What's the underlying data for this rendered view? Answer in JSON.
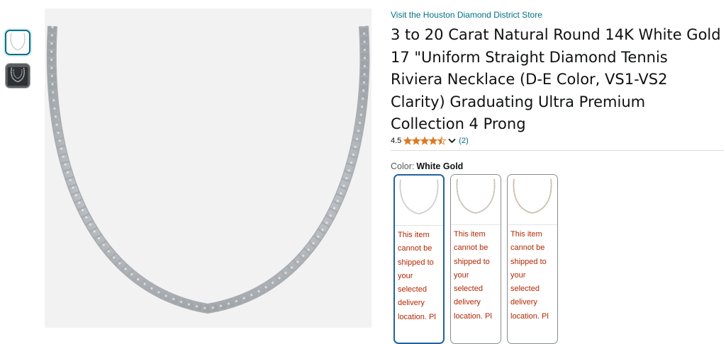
{
  "gallery": {
    "thumbnails": [
      {
        "icon": "necklace-thumbnail-icon",
        "selected": true
      },
      {
        "icon": "necklace-display-thumbnail-icon",
        "selected": false
      }
    ],
    "main_image_icon": "diamond-tennis-necklace-image"
  },
  "product": {
    "store_link": "Visit the Houston Diamond District Store",
    "title": "3 to 20 Carat Natural Round 14K White Gold 17 \"Uniform Straight Diamond Tennis Riviera Necklace (D-E Color, VS1-VS2 Clarity) Graduating Ultra Premium Collection 4 Prong",
    "rating": {
      "value": "4.5",
      "stars": 4.5,
      "count": "(2)",
      "star_color": "#DE7921"
    }
  },
  "color": {
    "label": "Color:",
    "selected_value": "White Gold",
    "swatches": [
      {
        "icon": "white-gold-necklace-swatch",
        "message": "This item cannot be shipped to your selected delivery location. Pl",
        "selected": true
      },
      {
        "icon": "rose-gold-necklace-swatch",
        "message": "This item cannot be shipped to your selected delivery location. Pl",
        "selected": false
      },
      {
        "icon": "yellow-gold-necklace-swatch",
        "message": "This item cannot be shipped to your selected delivery location. Pl",
        "selected": false
      }
    ]
  },
  "colors": {
    "link": "#007185",
    "warning": "#B12704",
    "selected_border": "#2162a1"
  }
}
